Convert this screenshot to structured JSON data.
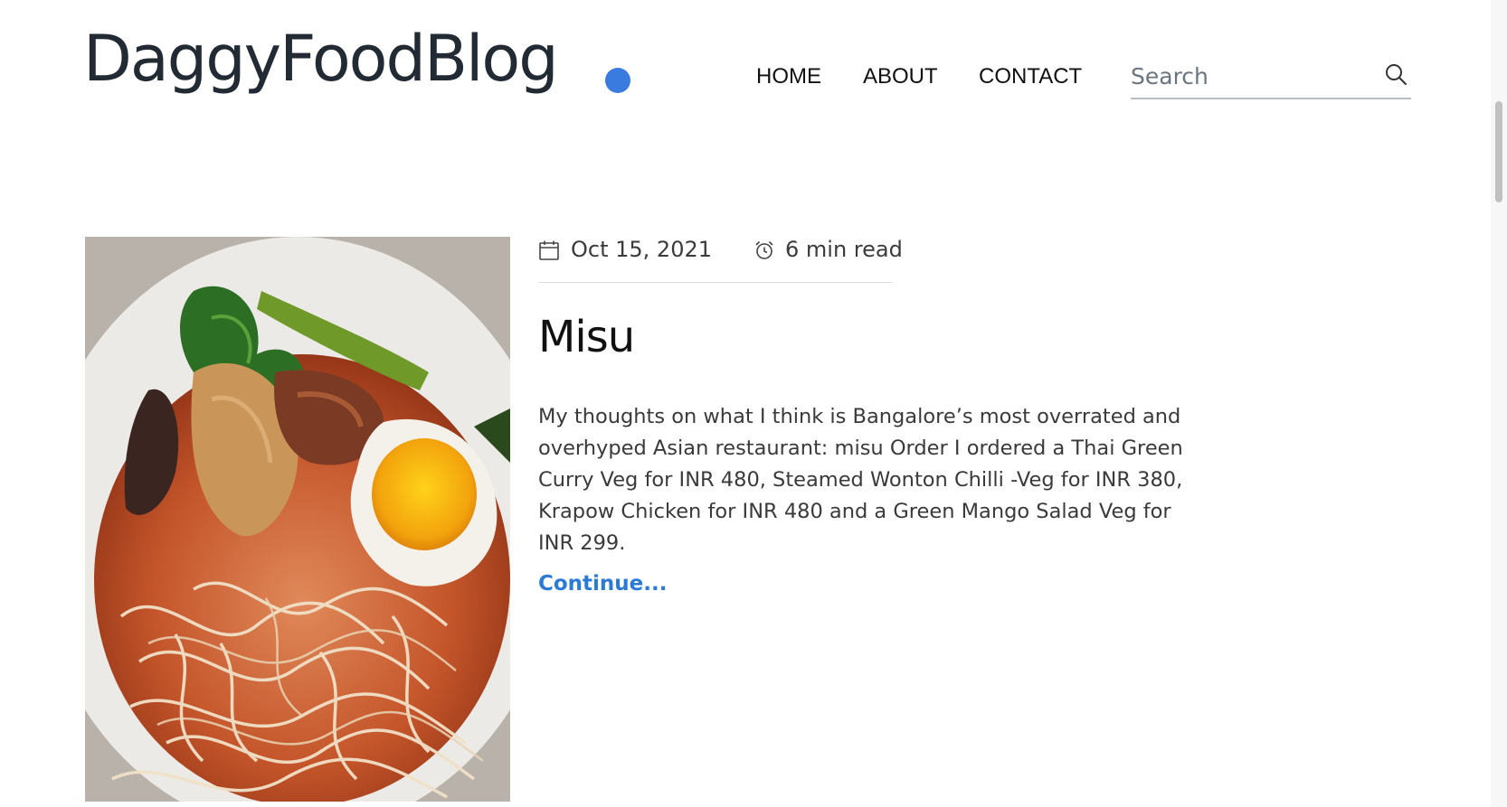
{
  "colors": {
    "accent": "#3a7be0",
    "link": "#2b7bd6"
  },
  "header": {
    "logo_text": "DaggyFoodBlog",
    "nav": [
      {
        "label": "HOME"
      },
      {
        "label": "ABOUT"
      },
      {
        "label": "CONTACT"
      }
    ],
    "search": {
      "placeholder": "Search",
      "value": "",
      "icon": "search-icon"
    }
  },
  "post": {
    "date": "Oct 15, 2021",
    "date_icon": "calendar-icon",
    "read_time": "6 min read",
    "read_time_icon": "alarm-clock-icon",
    "title": "Misu",
    "excerpt": "My thoughts on what I think is Bangalore’s most overrated and overhyped Asian restaurant: misu Order I ordered a Thai Green Curry Veg for INR 480, Steamed Wonton Chilli -Veg for INR 380, Krapow Chicken for INR 480 and a Green Mango Salad Veg for INR 299.",
    "continue_label": "Continue...",
    "image": "photo of noodle soup bowl with egg"
  }
}
